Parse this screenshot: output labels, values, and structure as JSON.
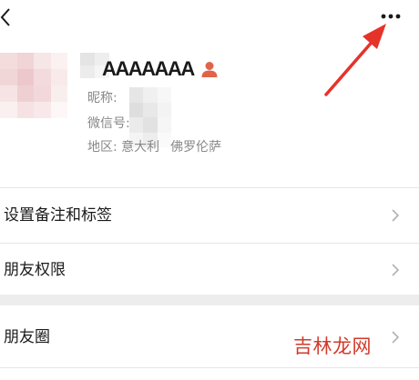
{
  "header": {
    "back_icon": "chevron-left-icon",
    "more_icon": "more-horizontal-icon"
  },
  "profile": {
    "display_name": "AAAAAAA",
    "person_icon": "person-silhouette-icon",
    "person_icon_color": "#e0644a",
    "nickname_label": "昵称:",
    "wechat_id_label": "微信号:",
    "region_label": "地区:",
    "region_country": "意大利",
    "region_city": "佛罗伦萨"
  },
  "menu": {
    "items": [
      {
        "label": "设置备注和标签"
      },
      {
        "label": "朋友权限"
      },
      {
        "label": "朋友圈"
      }
    ],
    "chevron_icon": "chevron-right-icon"
  },
  "annotation": {
    "arrow_icon": "red-arrow-icon",
    "color": "#e5332a"
  },
  "watermark": {
    "text": "吉林龙网",
    "color": "#d23a2c"
  },
  "colors": {
    "text_primary": "#1a1a1a",
    "text_secondary": "#888888",
    "divider": "#e6e6e6",
    "section_gap": "#ededed"
  }
}
